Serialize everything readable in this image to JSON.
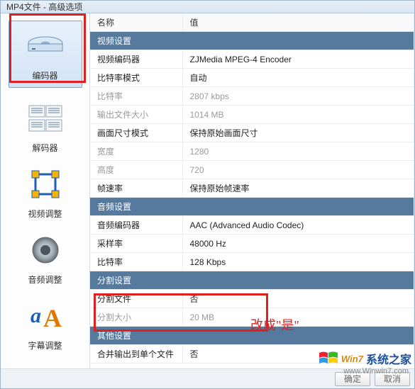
{
  "window": {
    "title": "MP4文件 - 高级选项"
  },
  "sidebar": {
    "items": [
      {
        "label": "编码器",
        "selected": true
      },
      {
        "label": "解码器",
        "selected": false
      },
      {
        "label": "视频调整",
        "selected": false
      },
      {
        "label": "音频调整",
        "selected": false
      },
      {
        "label": "字幕调整",
        "selected": false
      }
    ]
  },
  "columns": {
    "name": "名称",
    "value": "值"
  },
  "sections": [
    {
      "title": "视频设置",
      "rows": [
        {
          "name": "视频编码器",
          "value": "ZJMedia MPEG-4 Encoder",
          "muted": false
        },
        {
          "name": "比特率模式",
          "value": "自动",
          "muted": false
        },
        {
          "name": "比特率",
          "value": "2807 kbps",
          "muted": true
        },
        {
          "name": "输出文件大小",
          "value": "1014 MB",
          "muted": true
        },
        {
          "name": "画面尺寸模式",
          "value": "保持原始画面尺寸",
          "muted": false
        },
        {
          "name": "宽度",
          "value": "1280",
          "muted": true
        },
        {
          "name": "高度",
          "value": "720",
          "muted": true
        },
        {
          "name": "帧速率",
          "value": "保持原始帧速率",
          "muted": false
        }
      ]
    },
    {
      "title": "音频设置",
      "rows": [
        {
          "name": "音频编码器",
          "value": "AAC (Advanced Audio Codec)",
          "muted": false
        },
        {
          "name": "采样率",
          "value": "48000 Hz",
          "muted": false
        },
        {
          "name": "比特率",
          "value": "128 Kbps",
          "muted": false
        }
      ]
    },
    {
      "title": "分割设置",
      "rows": [
        {
          "name": "分割文件",
          "value": "否",
          "muted": false
        },
        {
          "name": "分割大小",
          "value": "20 MB",
          "muted": true
        }
      ]
    },
    {
      "title": "其他设置",
      "rows": [
        {
          "name": "合并输出到单个文件",
          "value": "否",
          "muted": false
        }
      ]
    }
  ],
  "annotation": "改成\"是\"",
  "footer": {
    "ok": "确定",
    "cancel": "取消"
  },
  "watermark": {
    "brand1": "Win7",
    "brand2": "系统之家",
    "url": "www.Winwin7.com"
  }
}
